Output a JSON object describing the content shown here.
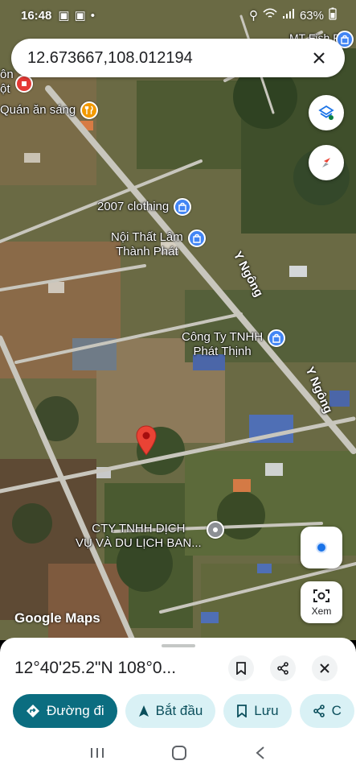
{
  "status_bar": {
    "time": "16:48",
    "battery": "63%"
  },
  "search": {
    "value": "12.673667,108.012194"
  },
  "map": {
    "road_labels": [
      "Y Ngông",
      "Y Ngông"
    ],
    "pois": [
      {
        "label_top": "ôn",
        "label_bottom": "ột"
      },
      {
        "label": "Quán ăn sáng"
      },
      {
        "label": "2007 clothing"
      },
      {
        "label": "Nội Thất Lâm\nThành Phát"
      },
      {
        "label": "Công Ty TNHH\nPhát Thịnh"
      },
      {
        "label": "CTY TNHH DỊCH\nVỤ VÀ DU LỊCH BAN..."
      },
      {
        "label": "MT Fish Fa"
      }
    ],
    "logo": "Google Maps",
    "lens_label": "Xem"
  },
  "sheet": {
    "title": "12°40'25.2\"N 108°0...",
    "chips": {
      "directions": "Đường đi",
      "start": "Bắt đầu",
      "save": "Lưu",
      "share_partial": "C"
    }
  },
  "colors": {
    "primary": "#0b6d80",
    "secondary_chip": "#d9f1f5",
    "poi_shop": "#4285f4",
    "pin": "#e53935"
  },
  "icons": [
    "layers-icon",
    "compass-icon",
    "my-location-icon",
    "lens-icon",
    "bookmark-icon",
    "share-icon",
    "close-icon",
    "directions-icon",
    "navigation-icon"
  ]
}
